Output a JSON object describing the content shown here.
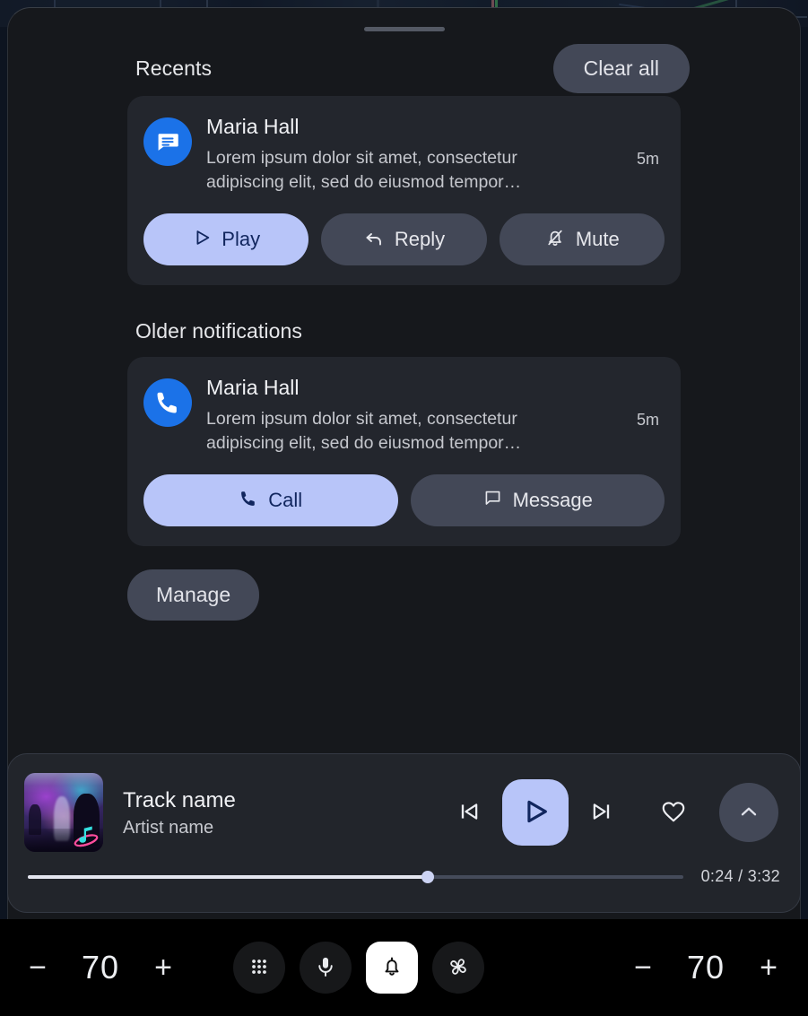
{
  "shade": {
    "drag_handle": "drag-handle",
    "sections": [
      {
        "title": "Recents",
        "clear_all_label": "Clear all"
      },
      {
        "title": "Older notifications"
      }
    ],
    "manage_label": "Manage"
  },
  "notifications": [
    {
      "app_icon": "messages-icon",
      "title": "Maria Hall",
      "body": "Lorem ipsum dolor sit amet, consectetur adipiscing elit, sed do eiusmod tempor…",
      "time": "5m",
      "actions": [
        {
          "label": "Play",
          "icon": "play-icon",
          "style": "filled"
        },
        {
          "label": "Reply",
          "icon": "reply-icon",
          "style": "tonal"
        },
        {
          "label": "Mute",
          "icon": "bell-off-icon",
          "style": "tonal"
        }
      ]
    },
    {
      "app_icon": "phone-icon",
      "title": "Maria Hall",
      "body": "Lorem ipsum dolor sit amet, consectetur adipiscing elit, sed do eiusmod tempor…",
      "time": "5m",
      "actions": [
        {
          "label": "Call",
          "icon": "phone-icon",
          "style": "filled"
        },
        {
          "label": "Message",
          "icon": "message-icon",
          "style": "tonal"
        }
      ]
    }
  ],
  "media": {
    "album_art": "concert-album-art",
    "track_name": "Track name",
    "artist_name": "Artist name",
    "controls": [
      {
        "name": "previous-track",
        "icon": "skip-previous-icon"
      },
      {
        "name": "play",
        "icon": "play-icon"
      },
      {
        "name": "next-track",
        "icon": "skip-next-icon"
      },
      {
        "name": "favorite",
        "icon": "heart-icon"
      },
      {
        "name": "expand",
        "icon": "chevron-up-icon"
      }
    ],
    "elapsed": "0:24",
    "duration": "3:32",
    "time_label": "0:24 / 3:32",
    "progress_percent": 61
  },
  "navbar": {
    "left_volume": {
      "minus": "−",
      "value": "70",
      "plus": "+"
    },
    "right_volume": {
      "minus": "−",
      "value": "70",
      "plus": "+"
    },
    "center_buttons": [
      {
        "name": "apps-grid",
        "icon": "apps-grid-icon",
        "active": false
      },
      {
        "name": "assistant",
        "icon": "microphone-icon",
        "active": false
      },
      {
        "name": "notifications",
        "icon": "bell-icon",
        "active": true
      },
      {
        "name": "climate",
        "icon": "fan-icon",
        "active": false
      }
    ]
  },
  "colors": {
    "accent": "#b8c5f9",
    "accent_text": "#11265e",
    "tonal": "#434857",
    "card": "#23262d",
    "shade_bg": "#16181c",
    "app_blue": "#1b72e8",
    "nav_bg": "#000000"
  }
}
